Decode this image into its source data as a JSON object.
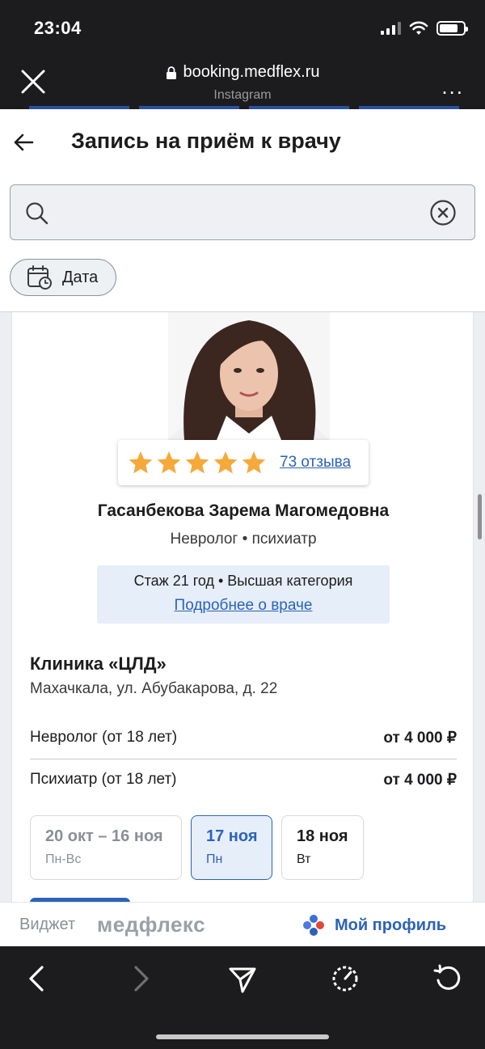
{
  "status_bar": {
    "time": "23:04",
    "battery_level": 0.8
  },
  "browser": {
    "url": "booking.medflex.ru",
    "source": "Instagram",
    "more": "..."
  },
  "header": {
    "title": "Запись на приём к врачу"
  },
  "search": {
    "placeholder": "",
    "value": ""
  },
  "filters": {
    "date_label": "Дата"
  },
  "doctor": {
    "rating_stars": 5,
    "reviews_label": "73 отзыва",
    "name": "Гасанбекова Зарема Магомедовна",
    "specialties": "Невролог • психиатр",
    "experience": "Стаж 21 год • Высшая категория",
    "details_link": "Подробнее о враче"
  },
  "clinic": {
    "name": "Клиника «ЦЛД»",
    "address": "Махачкала, ул. Абубакарова, д. 22",
    "services": [
      {
        "name": "Невролог (от 18 лет)",
        "price": "от 4 000 ₽"
      },
      {
        "name": "Психиатр (от 18 лет)",
        "price": "от 4 000 ₽"
      }
    ],
    "dates": [
      {
        "main": "20 окт – 16 ноя",
        "sub": "Пн-Вс",
        "state": "inactive"
      },
      {
        "main": "17 ноя",
        "sub": "Пн",
        "state": "selected"
      },
      {
        "main": "18 ноя",
        "sub": "Вт",
        "state": "default"
      }
    ]
  },
  "widget": {
    "label": "Виджет",
    "brand": "медфлекс",
    "profile_label": "Мой профиль"
  },
  "colors": {
    "accent": "#2b63b8",
    "star": "#f6a93b",
    "chrome": "#1c1c1e"
  }
}
